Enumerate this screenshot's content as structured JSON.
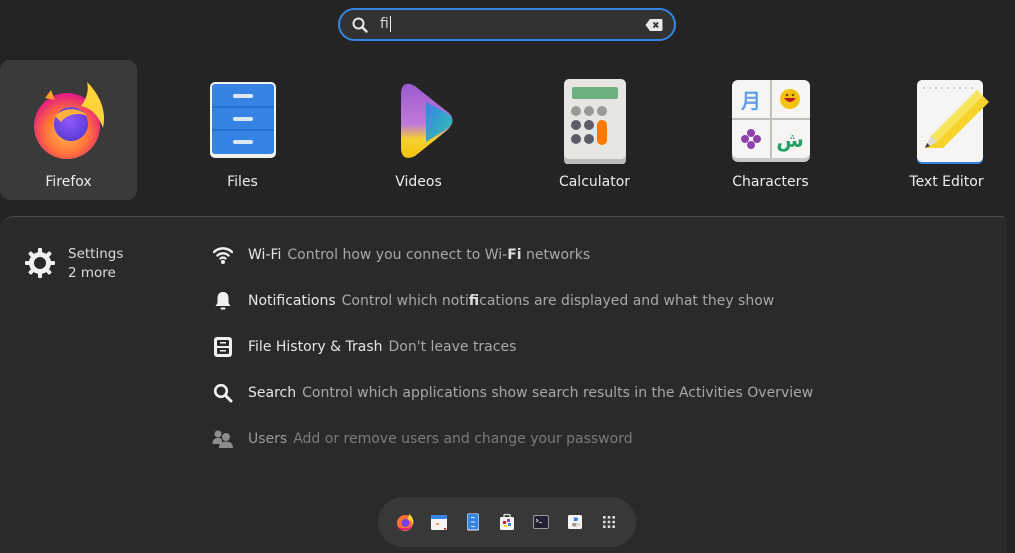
{
  "search": {
    "query": "fi",
    "search_icon": "search-icon",
    "clear_icon": "clear-backspace-icon",
    "accent_color": "#3584e4"
  },
  "apps": [
    {
      "label": "Firefox",
      "icon": "firefox-icon",
      "selected": true
    },
    {
      "label": "Files",
      "icon": "files-icon",
      "selected": false
    },
    {
      "label": "Videos",
      "icon": "videos-icon",
      "selected": false
    },
    {
      "label": "Calculator",
      "icon": "calculator-icon",
      "selected": false
    },
    {
      "label": "Characters",
      "icon": "characters-icon",
      "selected": false
    },
    {
      "label": "Text Editor",
      "icon": "text-editor-icon",
      "selected": false
    }
  ],
  "settings_provider": {
    "name": "Settings",
    "more": "2 more",
    "icon": "settings-gear-icon"
  },
  "results": [
    {
      "icon": "wifi-icon",
      "title": "Wi-Fi",
      "desc_parts": [
        "Control how you connect to Wi-",
        "Fi",
        " networks"
      ]
    },
    {
      "icon": "bell-icon",
      "title": "Notifications",
      "desc_parts": [
        "Control which noti",
        "fi",
        "cations are displayed and what they show"
      ]
    },
    {
      "icon": "file-cabinet-icon",
      "title": "File History & Trash",
      "desc_parts": [
        "Don't leave traces",
        "",
        ""
      ]
    },
    {
      "icon": "search-icon",
      "title": "Search",
      "desc_parts": [
        "Control which applications show search results in the Activities Overview",
        "",
        ""
      ]
    },
    {
      "icon": "users-icon",
      "title": "Users",
      "desc_parts": [
        "Add or remove users and change your password",
        "",
        ""
      ]
    }
  ],
  "dock": [
    {
      "name": "Firefox",
      "icon": "firefox-icon"
    },
    {
      "name": "Calendar",
      "icon": "calendar-icon"
    },
    {
      "name": "Files",
      "icon": "files-icon"
    },
    {
      "name": "Software",
      "icon": "software-bag-icon"
    },
    {
      "name": "Terminal",
      "icon": "terminal-icon"
    },
    {
      "name": "Settings",
      "icon": "settings-toggle-icon"
    },
    {
      "name": "Show Applications",
      "icon": "app-grid-icon"
    }
  ]
}
